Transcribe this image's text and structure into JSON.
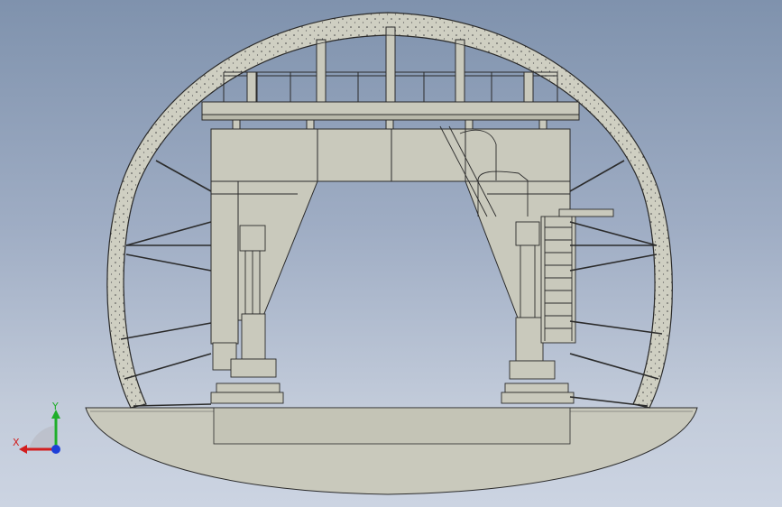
{
  "colors": {
    "background_top": "#7f92ad",
    "background_bottom": "#ccd4e2",
    "part_fill": "#c9c9bc",
    "part_fill_dark": "#b8b8aa",
    "edge": "#2b2b2b",
    "axis_x": "#d21e1e",
    "axis_y": "#1fae2a",
    "axis_z": "#1d3fd8"
  },
  "model": {
    "view": "front",
    "subject": "tunnel-lining-formwork-trolley"
  },
  "triad": {
    "x_label": "X",
    "y_label": "Y"
  }
}
